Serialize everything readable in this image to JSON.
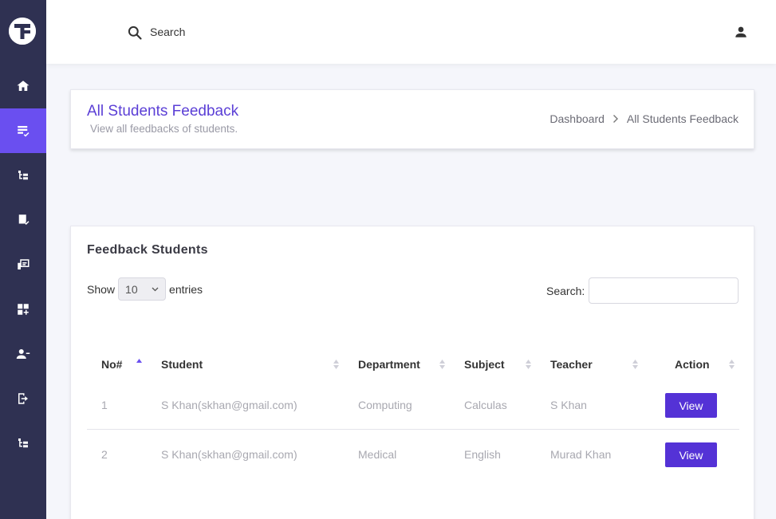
{
  "header": {
    "search_placeholder": "Search"
  },
  "sidebar": {
    "items": [
      {
        "icon": "home-icon",
        "active": false
      },
      {
        "icon": "feedback-icon",
        "active": true
      },
      {
        "icon": "hierarchy-icon",
        "active": false
      },
      {
        "icon": "book-icon",
        "active": false
      },
      {
        "icon": "presentation-icon",
        "active": false
      },
      {
        "icon": "apps-add-icon",
        "active": false
      },
      {
        "icon": "user-manage-icon",
        "active": false
      },
      {
        "icon": "logout-icon",
        "active": false
      },
      {
        "icon": "hierarchy-icon",
        "active": false
      }
    ]
  },
  "page": {
    "title": "All Students Feedback",
    "subtitle": "View all feedbacks of students.",
    "breadcrumb": [
      "Dashboard",
      "All Students Feedback"
    ]
  },
  "card": {
    "title": "Feedback Students",
    "show_label": "Show",
    "entries_value": "10",
    "entries_label": "entries",
    "search_label": "Search:"
  },
  "table": {
    "columns": [
      "No#",
      "Student",
      "Department",
      "Subject",
      "Teacher",
      "Action"
    ],
    "rows": [
      {
        "no": "1",
        "student": "S Khan(skhan@gmail.com)",
        "department": "Computing",
        "subject": "Calculas",
        "teacher": "S Khan",
        "action": "View"
      },
      {
        "no": "2",
        "student": "S Khan(skhan@gmail.com)",
        "department": "Medical",
        "subject": "English",
        "teacher": "Murad Khan",
        "action": "View"
      }
    ]
  },
  "colors": {
    "sidebar": "#2f3152",
    "accent": "#6a4ff0",
    "title": "#5b3fd6",
    "button": "#5432d6"
  }
}
